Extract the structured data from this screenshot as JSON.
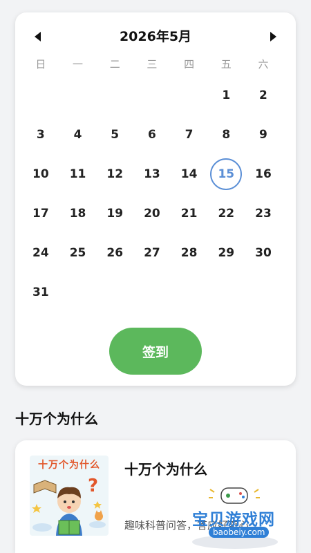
{
  "calendar": {
    "month_title": "2026年5月",
    "weekdays": [
      "日",
      "一",
      "二",
      "三",
      "四",
      "五",
      "六"
    ],
    "weeks": [
      [
        "",
        "",
        "",
        "",
        "",
        "1",
        "2"
      ],
      [
        "3",
        "4",
        "5",
        "6",
        "7",
        "8",
        "9"
      ],
      [
        "10",
        "11",
        "12",
        "13",
        "14",
        "15",
        "16"
      ],
      [
        "17",
        "18",
        "19",
        "20",
        "21",
        "22",
        "23"
      ],
      [
        "24",
        "25",
        "26",
        "27",
        "28",
        "29",
        "30"
      ],
      [
        "31",
        "",
        "",
        "",
        "",
        "",
        ""
      ]
    ],
    "today": "15",
    "checkin_label": "签到",
    "accent_color": "#5b8fd6",
    "button_color": "#5cb85c",
    "prev_icon": "triangle-left-icon",
    "next_icon": "triangle-right-icon"
  },
  "section": {
    "title": "十万个为什么"
  },
  "book": {
    "cover_title": "十万个为什么",
    "title": "十万个为什么",
    "description": "趣味科普问答，答应好奇心"
  },
  "watermark": {
    "text": "宝贝游戏网",
    "url": "baobeiy.com"
  }
}
